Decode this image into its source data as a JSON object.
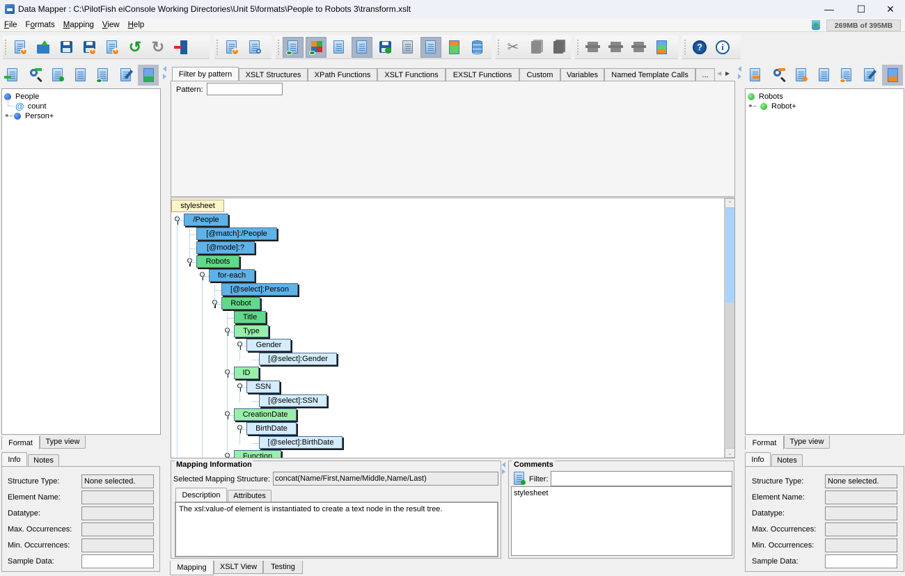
{
  "window": {
    "title": "Data Mapper : C:\\PilotFish eiConsole Working Directories\\Unit 5\\formats\\People to Robots 3\\transform.xslt",
    "controls": [
      "minimize",
      "maximize",
      "close"
    ]
  },
  "menubar": {
    "items": [
      {
        "label": "File",
        "mnemonic": "F"
      },
      {
        "label": "Formats",
        "mnemonic": "o"
      },
      {
        "label": "Mapping",
        "mnemonic": "M"
      },
      {
        "label": "View",
        "mnemonic": "V"
      },
      {
        "label": "Help",
        "mnemonic": "H"
      }
    ],
    "memory": "269MB of 395MB"
  },
  "toolbar": {
    "groups": [
      [
        "new-document-icon",
        "open-folder-icon",
        "save-icon",
        "save-as-icon",
        "export-xls-icon",
        "undo-icon",
        "redo-icon",
        "exit-icon"
      ],
      [
        "add-format-icon",
        "format-settings-icon"
      ],
      [
        "view-info-icon",
        "view-colors-icon",
        "checklist-icon",
        "xml-source-icon",
        "save-schedule-icon",
        "document-structure-icon",
        "namespace-icon",
        "layout-icon",
        "database-icon"
      ],
      [
        "cut-icon",
        "copy-icon",
        "paste-icon"
      ],
      [
        "move-up-icon",
        "move-center-icon",
        "move-down-icon",
        "color-stack-icon"
      ],
      [
        "help-icon",
        "about-icon"
      ]
    ]
  },
  "left_panel": {
    "tree": [
      {
        "label": "People",
        "icon": "blue-ball-icon",
        "expander": false
      },
      {
        "label": "count",
        "icon": "attribute-at-icon",
        "expander": false
      },
      {
        "label": "Person+",
        "icon": "blue-ball-icon",
        "expander": true
      }
    ],
    "view_tabs": [
      "Format",
      "Type view"
    ],
    "info_tabs": [
      "Info",
      "Notes"
    ],
    "info": {
      "structure_type_label": "Structure Type:",
      "structure_type_value": "None selected.",
      "element_name_label": "Element Name:",
      "element_name_value": "",
      "datatype_label": "Datatype:",
      "datatype_value": "",
      "max_occ_label": "Max. Occurrences:",
      "max_occ_value": "",
      "min_occ_label": "Min. Occurrences:",
      "min_occ_value": "",
      "sample_label": "Sample Data:",
      "sample_value": ""
    }
  },
  "right_panel": {
    "tree": [
      {
        "label": "Robots",
        "icon": "green-ball-icon",
        "expander": false
      },
      {
        "label": "Robot+",
        "icon": "green-ball-icon",
        "expander": true
      }
    ],
    "view_tabs": [
      "Format",
      "Type view"
    ],
    "info_tabs": [
      "Info",
      "Notes"
    ],
    "info": {
      "structure_type_label": "Structure Type:",
      "structure_type_value": "None selected.",
      "element_name_label": "Element Name:",
      "element_name_value": "",
      "datatype_label": "Datatype:",
      "datatype_value": "",
      "max_occ_label": "Max. Occurrences:",
      "max_occ_value": "",
      "min_occ_label": "Min. Occurrences:",
      "min_occ_value": "",
      "sample_label": "Sample Data:",
      "sample_value": ""
    }
  },
  "palette": {
    "tabs": [
      "Filter by pattern",
      "XSLT Structures",
      "XPath Functions",
      "XSLT Functions",
      "EXSLT Functions",
      "Custom",
      "Variables",
      "Named Template Calls",
      "..."
    ],
    "selected_tab": "Filter by pattern",
    "pattern_label": "Pattern:",
    "pattern_value": ""
  },
  "mapping_tree": {
    "nodes": [
      {
        "label": "stylesheet",
        "kind": "root"
      },
      {
        "label": "/People",
        "kind": "template"
      },
      {
        "label": "[@match]:/People",
        "kind": "attribute"
      },
      {
        "label": "[@mode]:?",
        "kind": "attribute"
      },
      {
        "label": "Robots",
        "kind": "target"
      },
      {
        "label": "for-each",
        "kind": "template"
      },
      {
        "label": "[@select]:Person",
        "kind": "attribute"
      },
      {
        "label": "Robot",
        "kind": "target"
      },
      {
        "label": "Title",
        "kind": "target"
      },
      {
        "label": "Type",
        "kind": "target-light"
      },
      {
        "label": "Gender",
        "kind": "source-light"
      },
      {
        "label": "[@select]:Gender",
        "kind": "source-light"
      },
      {
        "label": "ID",
        "kind": "target-light"
      },
      {
        "label": "SSN",
        "kind": "source-light"
      },
      {
        "label": "[@select]:SSN",
        "kind": "source-light"
      },
      {
        "label": "CreationDate",
        "kind": "target-light"
      },
      {
        "label": "BirthDate",
        "kind": "source-light"
      },
      {
        "label": "[@select]:BirthDate",
        "kind": "source-light"
      },
      {
        "label": "Function",
        "kind": "target-light"
      }
    ]
  },
  "mapping_info": {
    "title": "Mapping Information",
    "selected_label": "Selected Mapping Structure:",
    "selected_value": "concat(Name/First,Name/Middle,Name/Last)",
    "tabs": [
      "Description",
      "Attributes"
    ],
    "description": "The xsl:value-of element is instantiated to create a text node in the result tree."
  },
  "comments": {
    "title": "Comments",
    "filter_label": "Filter:",
    "filter_value": "",
    "items": [
      "stylesheet"
    ]
  },
  "bottom_tabs": [
    "Mapping",
    "XSLT View",
    "Testing"
  ],
  "colors": {
    "template_node": "#5fb2e8",
    "target_node": "#62d98a",
    "target_light_node": "#98f0a8",
    "source_light_node": "#d4ecfc",
    "root_node": "#fdf6c8"
  }
}
